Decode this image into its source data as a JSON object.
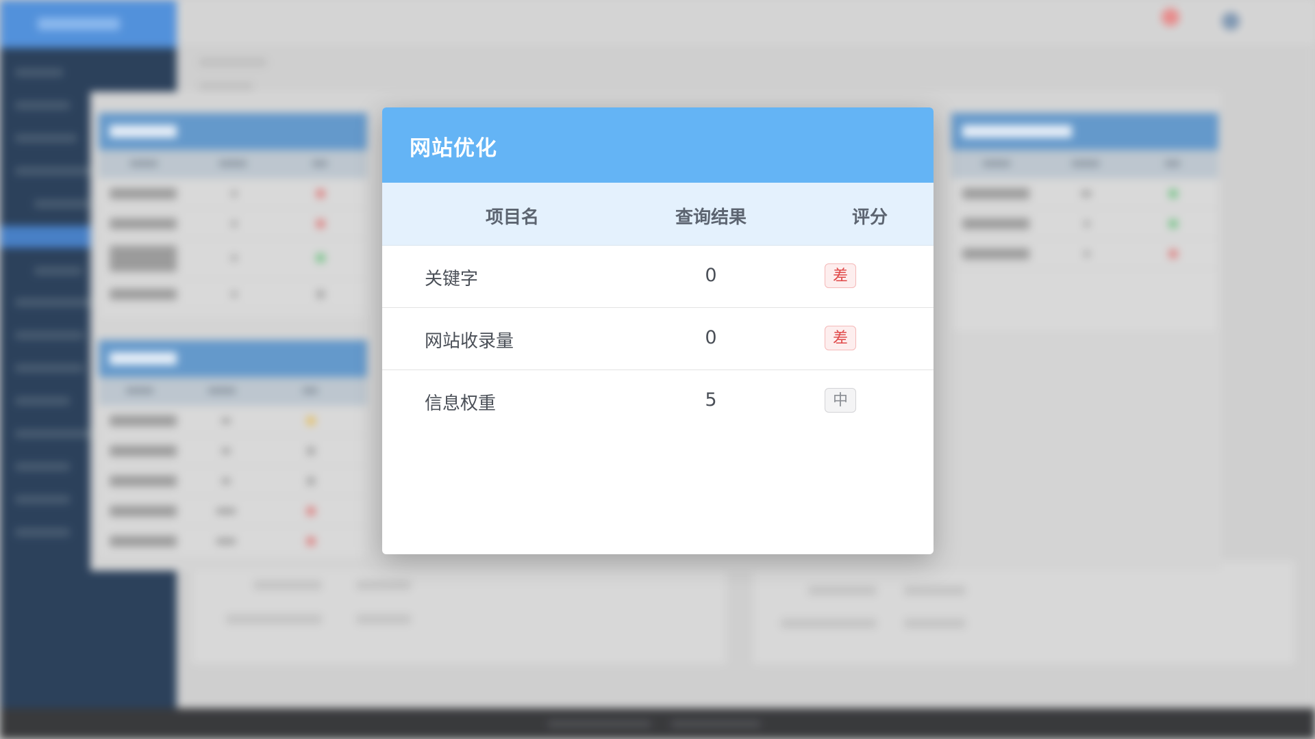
{
  "dialog": {
    "title": "网站优化",
    "columns": [
      "项目名",
      "查询结果",
      "评分"
    ],
    "rows": [
      {
        "name": "关键字",
        "result": "0",
        "score": "差",
        "score_level": "bad"
      },
      {
        "name": "网站收录量",
        "result": "0",
        "score": "差",
        "score_level": "bad"
      },
      {
        "name": "信息权重",
        "result": "5",
        "score": "中",
        "score_level": "mid"
      }
    ]
  },
  "colors": {
    "header_bg": "#64b4f5",
    "table_head_bg": "#e4f1fd",
    "bad_badge": "#e04848",
    "mid_badge": "#8a8d93",
    "sidebar_bg": "#0f2745"
  }
}
